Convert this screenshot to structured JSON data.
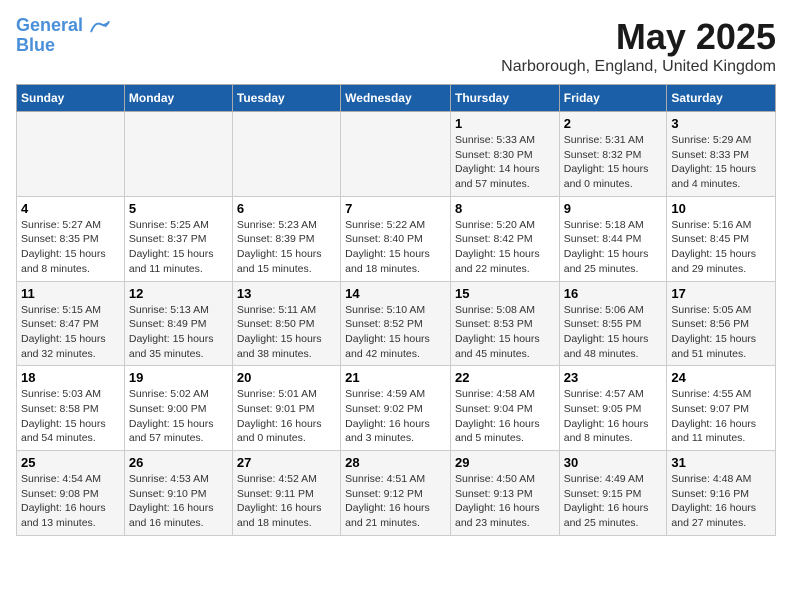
{
  "logo": {
    "line1": "General",
    "line2": "Blue"
  },
  "title": "May 2025",
  "subtitle": "Narborough, England, United Kingdom",
  "days_of_week": [
    "Sunday",
    "Monday",
    "Tuesday",
    "Wednesday",
    "Thursday",
    "Friday",
    "Saturday"
  ],
  "weeks": [
    [
      {
        "day": "",
        "info": ""
      },
      {
        "day": "",
        "info": ""
      },
      {
        "day": "",
        "info": ""
      },
      {
        "day": "",
        "info": ""
      },
      {
        "day": "1",
        "info": "Sunrise: 5:33 AM\nSunset: 8:30 PM\nDaylight: 14 hours\nand 57 minutes."
      },
      {
        "day": "2",
        "info": "Sunrise: 5:31 AM\nSunset: 8:32 PM\nDaylight: 15 hours\nand 0 minutes."
      },
      {
        "day": "3",
        "info": "Sunrise: 5:29 AM\nSunset: 8:33 PM\nDaylight: 15 hours\nand 4 minutes."
      }
    ],
    [
      {
        "day": "4",
        "info": "Sunrise: 5:27 AM\nSunset: 8:35 PM\nDaylight: 15 hours\nand 8 minutes."
      },
      {
        "day": "5",
        "info": "Sunrise: 5:25 AM\nSunset: 8:37 PM\nDaylight: 15 hours\nand 11 minutes."
      },
      {
        "day": "6",
        "info": "Sunrise: 5:23 AM\nSunset: 8:39 PM\nDaylight: 15 hours\nand 15 minutes."
      },
      {
        "day": "7",
        "info": "Sunrise: 5:22 AM\nSunset: 8:40 PM\nDaylight: 15 hours\nand 18 minutes."
      },
      {
        "day": "8",
        "info": "Sunrise: 5:20 AM\nSunset: 8:42 PM\nDaylight: 15 hours\nand 22 minutes."
      },
      {
        "day": "9",
        "info": "Sunrise: 5:18 AM\nSunset: 8:44 PM\nDaylight: 15 hours\nand 25 minutes."
      },
      {
        "day": "10",
        "info": "Sunrise: 5:16 AM\nSunset: 8:45 PM\nDaylight: 15 hours\nand 29 minutes."
      }
    ],
    [
      {
        "day": "11",
        "info": "Sunrise: 5:15 AM\nSunset: 8:47 PM\nDaylight: 15 hours\nand 32 minutes."
      },
      {
        "day": "12",
        "info": "Sunrise: 5:13 AM\nSunset: 8:49 PM\nDaylight: 15 hours\nand 35 minutes."
      },
      {
        "day": "13",
        "info": "Sunrise: 5:11 AM\nSunset: 8:50 PM\nDaylight: 15 hours\nand 38 minutes."
      },
      {
        "day": "14",
        "info": "Sunrise: 5:10 AM\nSunset: 8:52 PM\nDaylight: 15 hours\nand 42 minutes."
      },
      {
        "day": "15",
        "info": "Sunrise: 5:08 AM\nSunset: 8:53 PM\nDaylight: 15 hours\nand 45 minutes."
      },
      {
        "day": "16",
        "info": "Sunrise: 5:06 AM\nSunset: 8:55 PM\nDaylight: 15 hours\nand 48 minutes."
      },
      {
        "day": "17",
        "info": "Sunrise: 5:05 AM\nSunset: 8:56 PM\nDaylight: 15 hours\nand 51 minutes."
      }
    ],
    [
      {
        "day": "18",
        "info": "Sunrise: 5:03 AM\nSunset: 8:58 PM\nDaylight: 15 hours\nand 54 minutes."
      },
      {
        "day": "19",
        "info": "Sunrise: 5:02 AM\nSunset: 9:00 PM\nDaylight: 15 hours\nand 57 minutes."
      },
      {
        "day": "20",
        "info": "Sunrise: 5:01 AM\nSunset: 9:01 PM\nDaylight: 16 hours\nand 0 minutes."
      },
      {
        "day": "21",
        "info": "Sunrise: 4:59 AM\nSunset: 9:02 PM\nDaylight: 16 hours\nand 3 minutes."
      },
      {
        "day": "22",
        "info": "Sunrise: 4:58 AM\nSunset: 9:04 PM\nDaylight: 16 hours\nand 5 minutes."
      },
      {
        "day": "23",
        "info": "Sunrise: 4:57 AM\nSunset: 9:05 PM\nDaylight: 16 hours\nand 8 minutes."
      },
      {
        "day": "24",
        "info": "Sunrise: 4:55 AM\nSunset: 9:07 PM\nDaylight: 16 hours\nand 11 minutes."
      }
    ],
    [
      {
        "day": "25",
        "info": "Sunrise: 4:54 AM\nSunset: 9:08 PM\nDaylight: 16 hours\nand 13 minutes."
      },
      {
        "day": "26",
        "info": "Sunrise: 4:53 AM\nSunset: 9:10 PM\nDaylight: 16 hours\nand 16 minutes."
      },
      {
        "day": "27",
        "info": "Sunrise: 4:52 AM\nSunset: 9:11 PM\nDaylight: 16 hours\nand 18 minutes."
      },
      {
        "day": "28",
        "info": "Sunrise: 4:51 AM\nSunset: 9:12 PM\nDaylight: 16 hours\nand 21 minutes."
      },
      {
        "day": "29",
        "info": "Sunrise: 4:50 AM\nSunset: 9:13 PM\nDaylight: 16 hours\nand 23 minutes."
      },
      {
        "day": "30",
        "info": "Sunrise: 4:49 AM\nSunset: 9:15 PM\nDaylight: 16 hours\nand 25 minutes."
      },
      {
        "day": "31",
        "info": "Sunrise: 4:48 AM\nSunset: 9:16 PM\nDaylight: 16 hours\nand 27 minutes."
      }
    ]
  ]
}
